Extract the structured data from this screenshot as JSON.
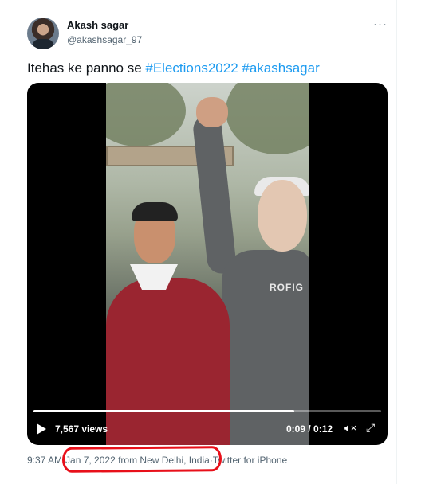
{
  "author": {
    "name": "Akash sagar",
    "handle": "@akashsagar_97"
  },
  "tweet": {
    "text_plain": "Itehas ke panno se ",
    "hashtags": [
      "#Elections2022",
      "#akashsagar"
    ]
  },
  "video": {
    "views": "7,567 views",
    "elapsed": "0:09",
    "separator": " / ",
    "duration": "0:12",
    "progress": 0.75,
    "hoodie_text": "ROFIG",
    "icons": [
      "play-icon",
      "mute-icon",
      "fullscreen-icon"
    ]
  },
  "meta": {
    "time": "9:37 AM",
    "dot1": " · ",
    "date_location": "Jan 7, 2022 from New Delhi, India",
    "dot2": " · ",
    "client": "Twitter for iPhone"
  },
  "colors": {
    "hashtag": "#1d9bf0",
    "annotation_ellipse": "#e8101a"
  }
}
